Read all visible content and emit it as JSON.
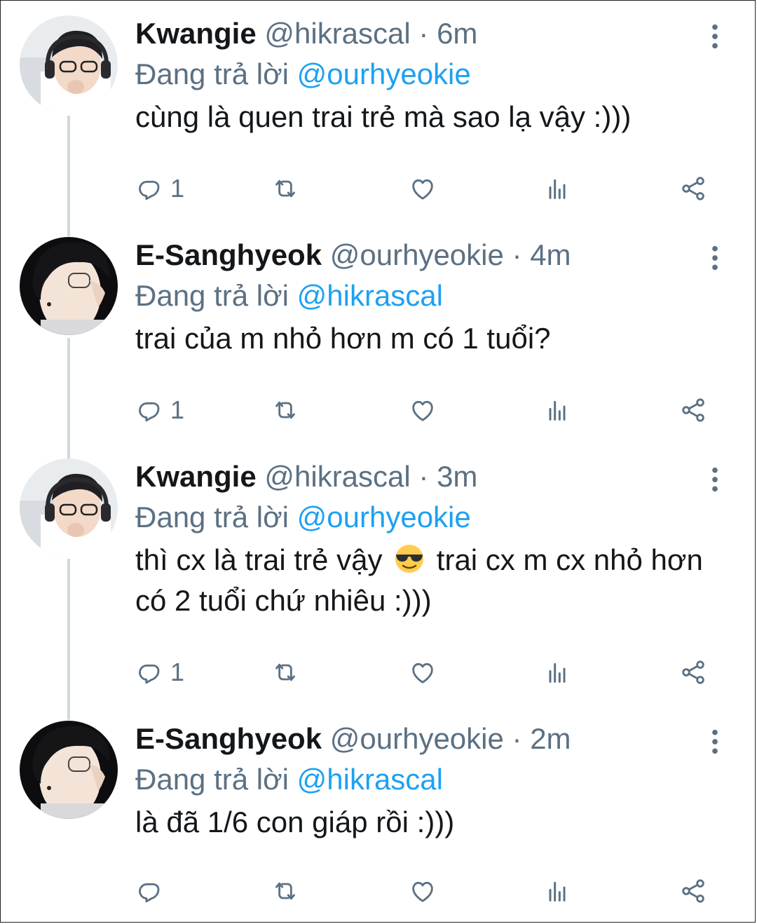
{
  "tweets": [
    {
      "name": "Kwangie",
      "handle": "@hikrascal",
      "time": "6m",
      "replying_prefix": "Đang trả lời",
      "replying_to": "@ourhyeokie",
      "text": "cùng là quen trai trẻ mà sao lạ vậy :)))",
      "reply_count": "1",
      "avatar": "kwangie-avatar"
    },
    {
      "name": "E-Sanghyeok",
      "handle": "@ourhyeokie",
      "time": "4m",
      "replying_prefix": "Đang trả lời",
      "replying_to": "@hikrascal",
      "text": "trai của m nhỏ hơn m có 1 tuổi?",
      "reply_count": "1",
      "avatar": "sanghyeok-avatar"
    },
    {
      "name": "Kwangie",
      "handle": "@hikrascal",
      "time": "3m",
      "replying_prefix": "Đang trả lời",
      "replying_to": "@ourhyeokie",
      "text_before_emoji": "thì cx là trai trẻ vậy",
      "emoji": "smiling-face-with-sunglasses",
      "text_after_emoji": "trai cx m cx nhỏ hơn có 2 tuổi chứ nhiêu :)))",
      "reply_count": "1",
      "avatar": "kwangie-avatar"
    },
    {
      "name": "E-Sanghyeok",
      "handle": "@ourhyeokie",
      "time": "2m",
      "replying_prefix": "Đang trả lời",
      "replying_to": "@hikrascal",
      "text": "là đã 1/6 con giáp rồi :)))",
      "reply_count": "",
      "avatar": "sanghyeok-avatar"
    }
  ],
  "separator": "·",
  "colors": {
    "mention": "#1da1f2",
    "muted": "#5b7083",
    "text": "#14171a",
    "thread_line": "#cfd9de"
  }
}
